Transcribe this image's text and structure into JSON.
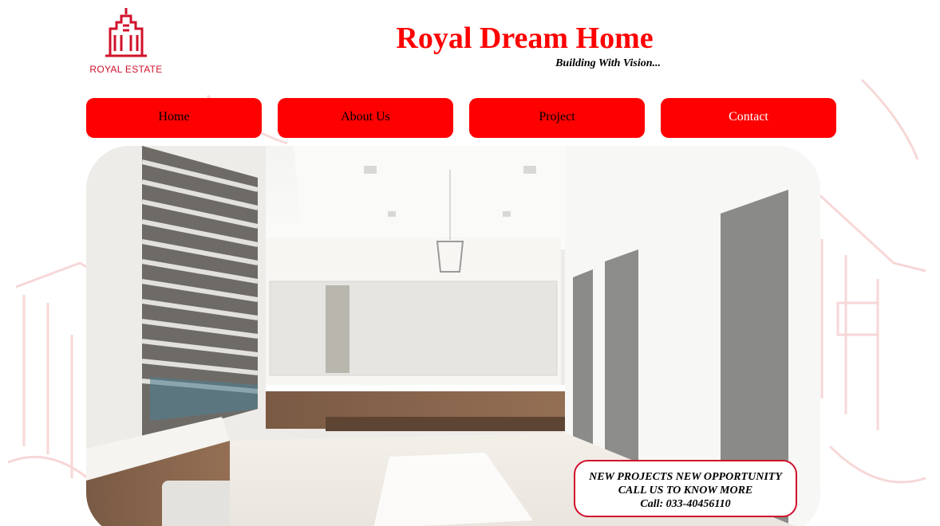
{
  "brand": {
    "logo_text": "ROYAL ESTATE",
    "title": "Royal Dream Home",
    "tagline": "Building With Vision..."
  },
  "nav": {
    "items": [
      {
        "label": "Home"
      },
      {
        "label": "About Us"
      },
      {
        "label": "Project"
      },
      {
        "label": "Contact"
      }
    ]
  },
  "hero": {
    "image": "luxury-bathroom-interior"
  },
  "promo": {
    "line1": "NEW PROJECTS NEW OPPORTUNITY",
    "line2": "CALL US TO KNOW MORE",
    "line3": "Call: 033-40456110"
  },
  "colors": {
    "brand_red": "#ff0000",
    "logo_red": "#d0112b",
    "text": "#000000",
    "background": "#ffffff"
  }
}
